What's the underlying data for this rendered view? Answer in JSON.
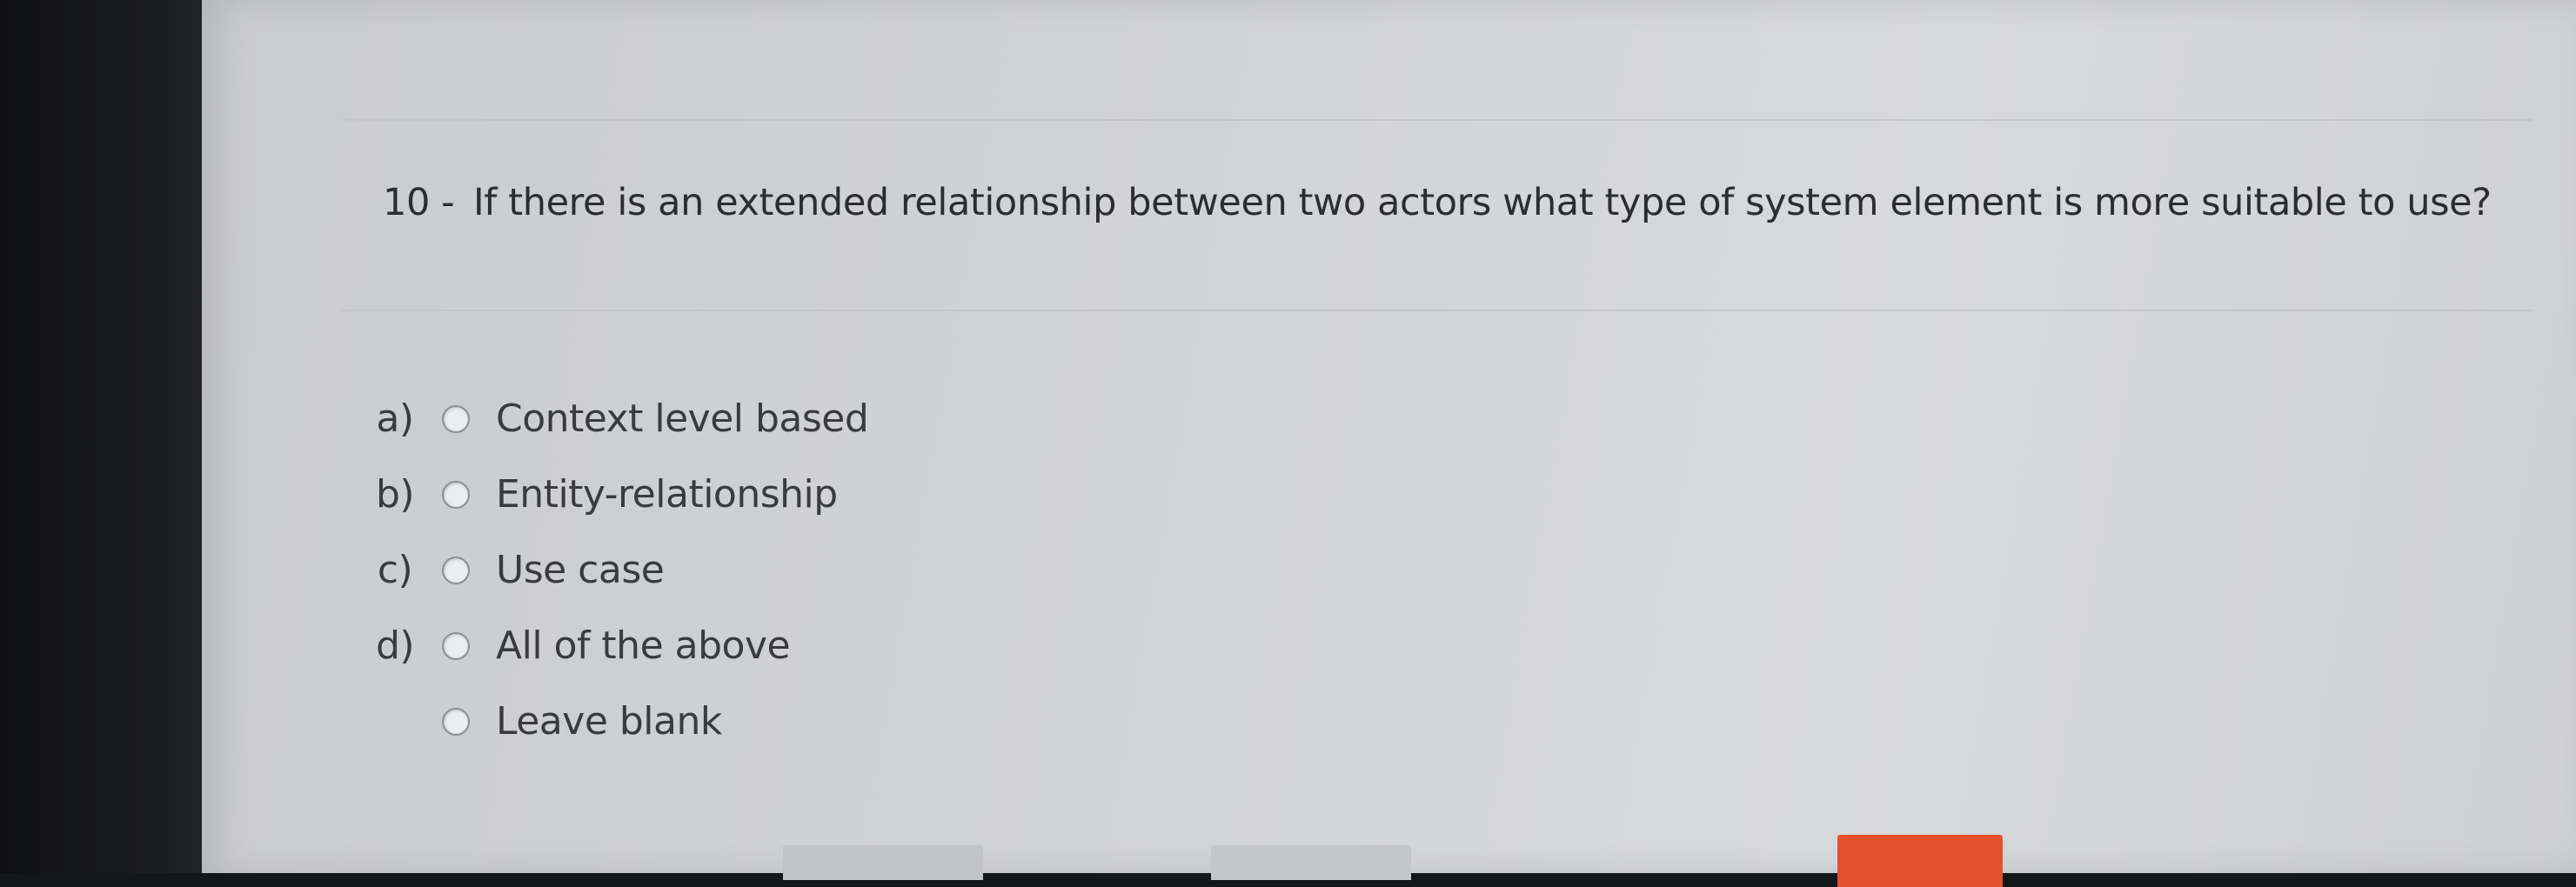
{
  "question": {
    "number": "10 -",
    "text": "If there is an extended relationship between two actors what type of system element is more suitable to use?"
  },
  "options": [
    {
      "letter": "a)",
      "label": "Context level based"
    },
    {
      "letter": "b)",
      "label": "Entity-relationship"
    },
    {
      "letter": "c)",
      "label": "Use case"
    },
    {
      "letter": "d)",
      "label": "All of the above"
    },
    {
      "letter": "",
      "label": "Leave blank"
    }
  ],
  "colors": {
    "accent_button": "#e1512b",
    "page_background": "#d3d4d9"
  },
  "icons": {
    "radio": "radio-button-unselected-icon"
  }
}
